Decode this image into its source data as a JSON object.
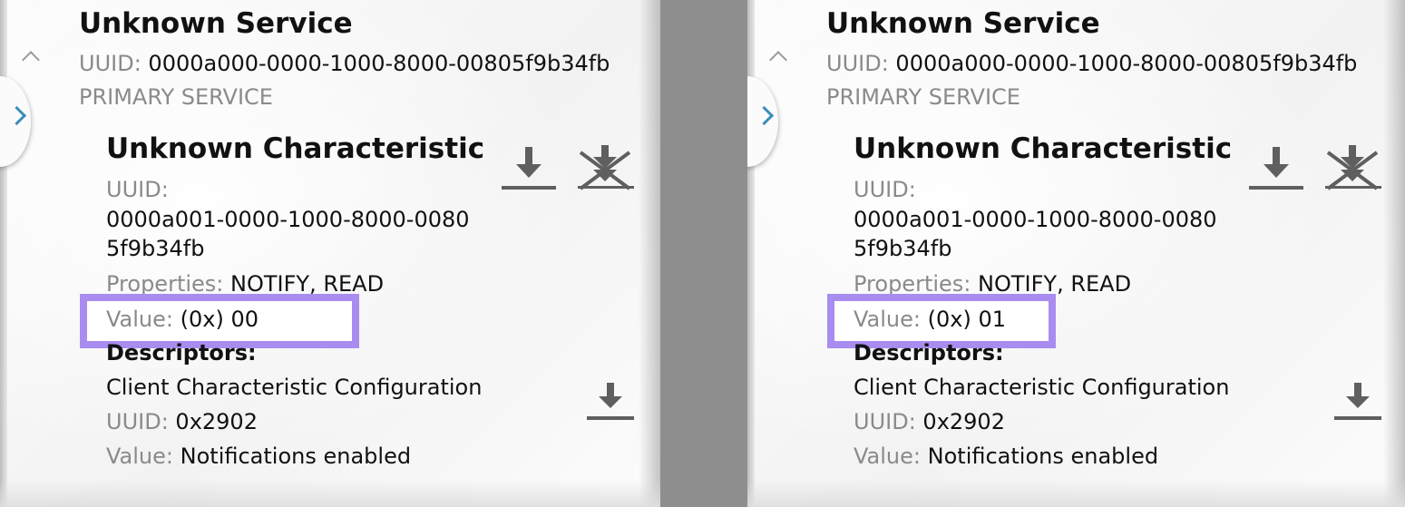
{
  "panels": [
    {
      "service": {
        "title": "Unknown Service",
        "uuid_label": "UUID:",
        "uuid": "0000a000-0000-1000-8000-00805f9b34fb",
        "type": "PRIMARY SERVICE"
      },
      "characteristic": {
        "title": "Unknown Characteristic",
        "uuid_label": "UUID:",
        "uuid_line1": "0000a001-0000-1000-8000-0080",
        "uuid_line2": "5f9b34fb",
        "properties_label": "Properties:",
        "properties": "NOTIFY, READ",
        "value_label": "Value:",
        "value": "(0x) 00"
      },
      "descriptors": {
        "heading": "Descriptors:",
        "name": "Client Characteristic Configuration",
        "uuid_label": "UUID:",
        "uuid": "0x2902",
        "value_label": "Value:",
        "value": "Notifications enabled"
      }
    },
    {
      "service": {
        "title": "Unknown Service",
        "uuid_label": "UUID:",
        "uuid": "0000a000-0000-1000-8000-00805f9b34fb",
        "type": "PRIMARY SERVICE"
      },
      "characteristic": {
        "title": "Unknown Characteristic",
        "uuid_label": "UUID:",
        "uuid_line1": "0000a001-0000-1000-8000-0080",
        "uuid_line2": "5f9b34fb",
        "properties_label": "Properties:",
        "properties": "NOTIFY, READ",
        "value_label": "Value:",
        "value": "(0x) 01"
      },
      "descriptors": {
        "heading": "Descriptors:",
        "name": "Client Characteristic Configuration",
        "uuid_label": "UUID:",
        "uuid": "0x2902",
        "value_label": "Value:",
        "value": "Notifications enabled"
      }
    }
  ],
  "icons": {
    "read": "download-icon",
    "notify": "notifications-disabled-icon",
    "collapse": "chevron-up-icon",
    "drawer": "chevron-right-icon"
  },
  "colors": {
    "highlight": "#a98cf0",
    "accent": "#3a8dbc",
    "divider": "#8e8e8e"
  }
}
